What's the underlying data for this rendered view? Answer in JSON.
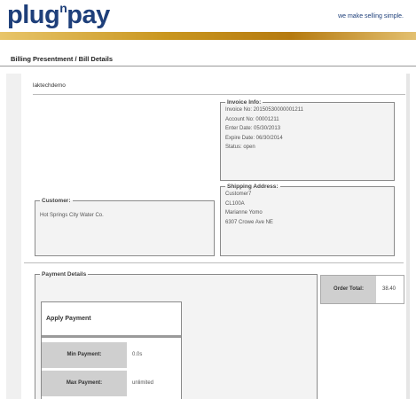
{
  "header": {
    "logo_text": "plug",
    "logo_sup": "n",
    "logo_text2": "pay",
    "tagline": "we make selling simple.",
    "accent_color": "#c9961f",
    "brand_color": "#1e3f7a"
  },
  "page_title": "Billing Presentment / Bill Details",
  "merchant": "laktechdemo",
  "invoice": {
    "legend": "Invoice Info:",
    "lines": [
      "Invoice No: 20150530000001211",
      "Account No: 00001211",
      "Enter Date: 05/30/2013",
      "Expire Date: 06/30/2014",
      "Status: open"
    ]
  },
  "shipping": {
    "legend": "Shipping Address:",
    "lines": [
      "Customer7",
      "CL100A",
      "Marianne Yomo",
      "6307 Crowe Ave NE"
    ]
  },
  "customer": {
    "legend": "Customer:",
    "name": "Hot Springs City Water Co."
  },
  "payment": {
    "legend": "Payment Details",
    "apply_title": "Apply Payment",
    "min_label": "Min Payment:",
    "min_value": "0.0s",
    "max_label": "Max Payment:",
    "max_value": "unlimited"
  },
  "order_total": {
    "label": "Order Total:",
    "value": "38.40"
  }
}
